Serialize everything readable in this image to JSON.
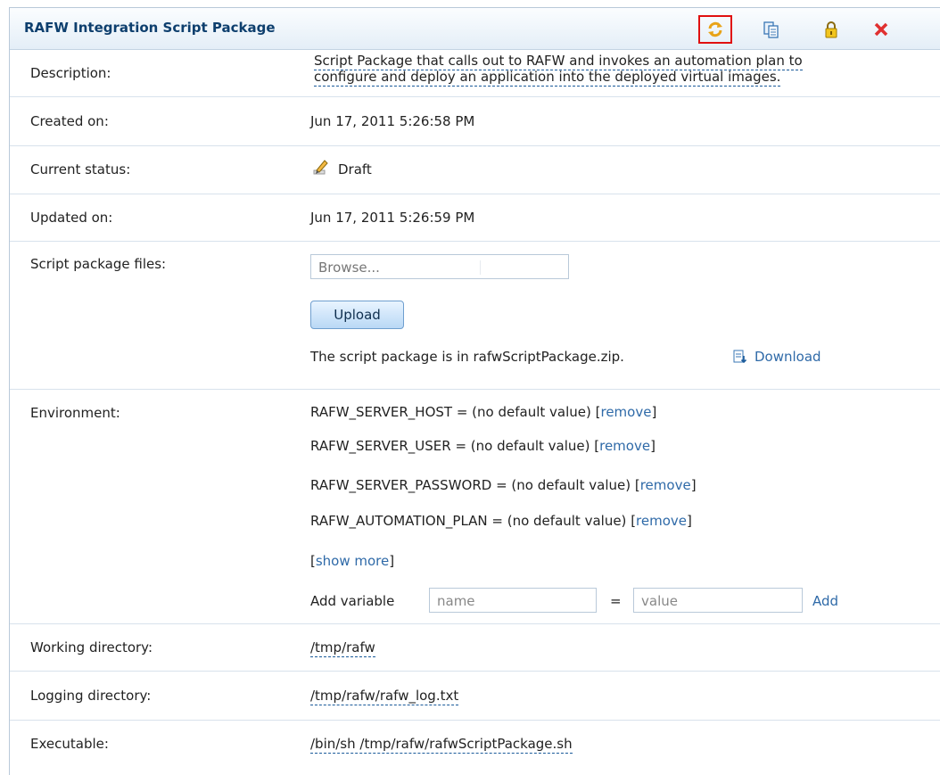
{
  "header": {
    "title": "RAFW Integration Script Package"
  },
  "toolbar": {
    "refresh_icon": "refresh-icon",
    "clone_icon": "clone-icon",
    "lock_icon": "lock-icon",
    "delete_icon": "delete-icon",
    "highlight_color": "#e01010"
  },
  "fields": {
    "description_label": "Description:",
    "description_line1": "Script Package that calls out to RAFW and invokes an automation plan to",
    "description_line2": "configure and deploy an application into the deployed virtual images.",
    "created_label": "Created on:",
    "created_value": "Jun 17, 2011 5:26:58 PM",
    "status_label": "Current status:",
    "status_value": "Draft",
    "updated_label": "Updated on:",
    "updated_value": "Jun 17, 2011 5:26:59 PM",
    "files_label": "Script package files:",
    "browse_placeholder": "Browse...",
    "upload_label": "Upload",
    "package_text": "The script package is in rafwScriptPackage.zip.",
    "download_label": "Download",
    "environment_label": "Environment:",
    "env_vars": [
      "RAFW_SERVER_HOST = (no default value) ",
      "RAFW_SERVER_USER = (no default value) ",
      "RAFW_SERVER_PASSWORD = (no default value) ",
      "RAFW_AUTOMATION_PLAN = (no default value) "
    ],
    "remove_label": "remove",
    "show_more_label": "show more",
    "add_variable_label": "Add variable",
    "name_placeholder": "name",
    "equals": "=",
    "value_placeholder": "value",
    "add_label": "Add",
    "working_label": "Working directory:",
    "working_value": "/tmp/rafw",
    "logging_label": "Logging directory:",
    "logging_value": "/tmp/rafw/rafw_log.txt",
    "executable_label": "Executable:",
    "executable_value": "/bin/sh /tmp/rafw/rafwScriptPackage.sh"
  }
}
